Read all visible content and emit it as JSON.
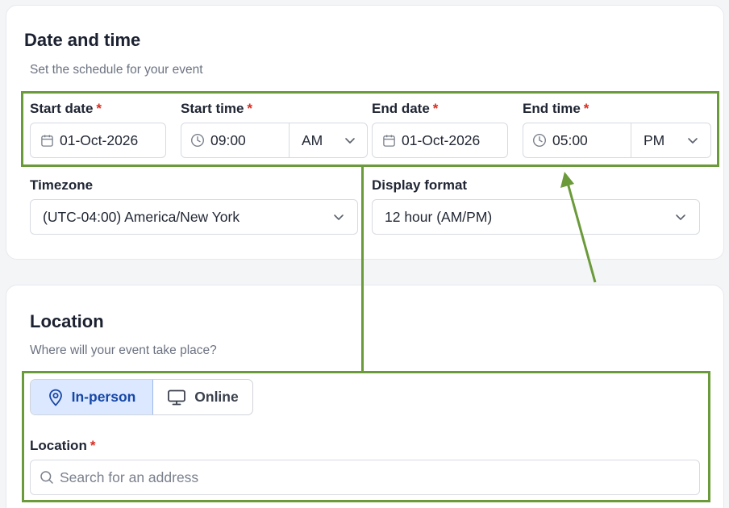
{
  "datetime": {
    "title": "Date and time",
    "subtitle": "Set the schedule for your event",
    "required_mark": "*",
    "start_date": {
      "label": "Start date",
      "value": "01-Oct-2026"
    },
    "start_time": {
      "label": "Start time",
      "value": "09:00",
      "period": "AM"
    },
    "end_date": {
      "label": "End date",
      "value": "01-Oct-2026"
    },
    "end_time": {
      "label": "End time",
      "value": "05:00",
      "period": "PM"
    },
    "timezone": {
      "label": "Timezone",
      "value": "(UTC-04:00) America/New York"
    },
    "display_format": {
      "label": "Display format",
      "value": "12 hour (AM/PM)"
    }
  },
  "location": {
    "title": "Location",
    "subtitle": "Where will your event take place?",
    "mode_options": [
      {
        "label": "In-person",
        "icon": "map-pin-icon",
        "selected": true
      },
      {
        "label": "Online",
        "icon": "monitor-icon",
        "selected": false
      }
    ],
    "field": {
      "label": "Location",
      "placeholder": "Search for an address"
    }
  },
  "colors": {
    "annotation": "#6a9a3a",
    "required": "#d92d20",
    "active_toggle_bg": "#dbe8ff",
    "active_toggle_text": "#1747a6"
  }
}
